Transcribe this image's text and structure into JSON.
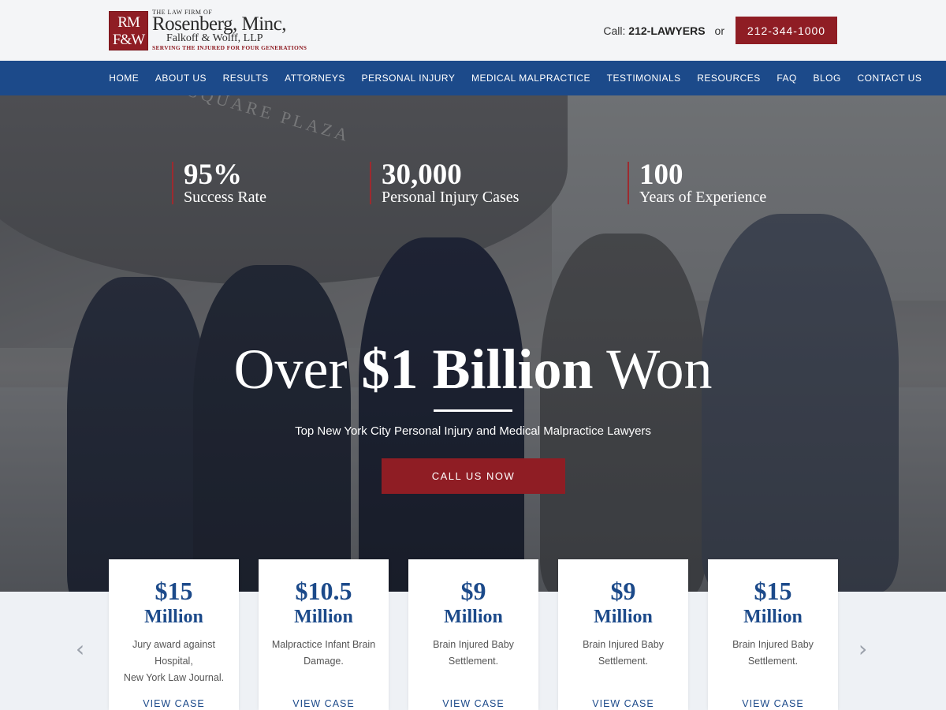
{
  "header": {
    "logo_mark": "RM\nF&W",
    "logo_small": "The Law Firm of",
    "logo_big": "Rosenberg, Minc,",
    "logo_mid": "Falkoff & Wolff, LLP",
    "logo_tag": "Serving the Injured for Four Generations",
    "call_label": "Call:",
    "call_vanity": "212-LAWYERS",
    "call_or": "or",
    "phone": "212-344-1000"
  },
  "nav": {
    "items": [
      "Home",
      "About Us",
      "Results",
      "Attorneys",
      "Personal Injury",
      "Medical Malpractice",
      "Testimonials",
      "Resources",
      "FAQ",
      "Blog",
      "Contact Us"
    ]
  },
  "hero": {
    "arch_sign": "PERSHING SQUARE PLAZA",
    "stats": [
      {
        "number": "95%",
        "label": "Success Rate"
      },
      {
        "number": "30,000",
        "label": "Personal Injury Cases"
      },
      {
        "number": "100",
        "label": "Years of Experience"
      }
    ],
    "headline_pre": "Over ",
    "headline_bold": "$1 Billion",
    "headline_post": " Won",
    "subtitle": "Top New York City Personal Injury and Medical Malpractice Lawyers",
    "cta": "Call Us Now"
  },
  "results": {
    "cards": [
      {
        "amount": "$15",
        "unit": "Million",
        "desc": "Jury award against\nHospital,\nNew York Law Journal.",
        "link": "View Case"
      },
      {
        "amount": "$10.5",
        "unit": "Million",
        "desc": "Malpractice Infant Brain\nDamage.",
        "link": "View Case"
      },
      {
        "amount": "$9",
        "unit": "Million",
        "desc": "Brain Injured Baby\nSettlement.",
        "link": "View Case"
      },
      {
        "amount": "$9",
        "unit": "Million",
        "desc": "Brain Injured Baby\nSettlement.",
        "link": "View Case"
      },
      {
        "amount": "$15",
        "unit": "Million",
        "desc": "Brain Injured Baby\nSettlement.",
        "link": "View Case"
      }
    ],
    "prev_arrow": "‹",
    "next_arrow": "›"
  },
  "colors": {
    "brand_red": "#8f1d24",
    "brand_blue": "#1c4a8a"
  }
}
